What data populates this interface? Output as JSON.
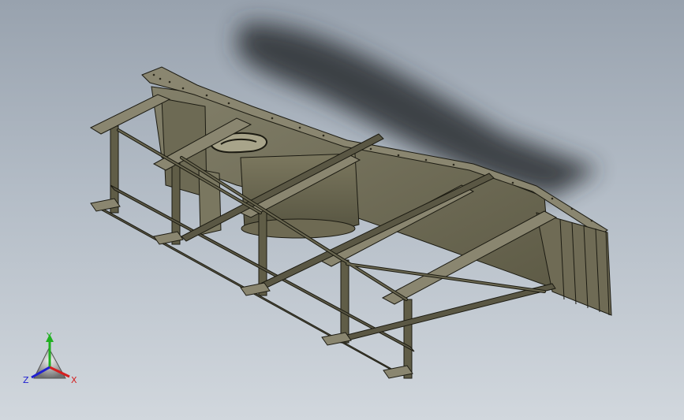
{
  "viewport": {
    "background_top": "#98a2ae",
    "background_bottom": "#d1d7dd"
  },
  "model": {
    "name": "steel-frame-platform-assembly",
    "frame_color": "#5f5c47",
    "panel_color": "#757159",
    "edge_color": "#1c1b12"
  },
  "triad": {
    "x_label": "X",
    "y_label": "Y",
    "z_label": "Z",
    "x_color": "#d42020",
    "y_color": "#20b020",
    "z_color": "#2020d0"
  }
}
